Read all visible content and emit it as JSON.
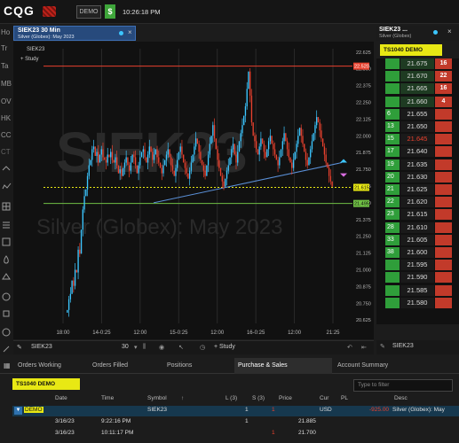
{
  "app": {
    "logo": "CQG",
    "demo_label": "DEMO",
    "dollar_label": "$",
    "clock": "10:26:18 PM",
    "accent_yellow": "#e8e814",
    "up_color": "#3cc6ff",
    "down_color": "#e8412e"
  },
  "rail": [
    "Ho",
    "Tr",
    "Ta",
    "MB",
    "OV",
    "HK",
    "CC",
    "CT"
  ],
  "chart_window": {
    "title": "SIEK23 30 Min",
    "subtitle": "Silver (Globex): May 2023",
    "legend_symbol": "SIEK23",
    "legend_study": "+ Study",
    "watermark_symbol": "SIEK23",
    "watermark_name": "Silver (Globex): May 2023"
  },
  "chart_data": {
    "type": "candlestick",
    "symbol": "SIEK23",
    "interval": "30 Min",
    "ylim": [
      20.6,
      22.65
    ],
    "y_ticks": [
      "22.625",
      "22.500",
      "22.375",
      "22.250",
      "22.125",
      "22.000",
      "21.875",
      "21.750",
      "21.625",
      "21.500",
      "21.375",
      "21.250",
      "21.125",
      "21.000",
      "20.875",
      "20.750",
      "20.625"
    ],
    "x_ticks": [
      "18:00",
      "14-0:25",
      "12:00",
      "15-0:25",
      "12:00",
      "16-0:25",
      "12:00",
      "21:25"
    ],
    "price_labels": [
      {
        "label": "22.520",
        "value": 22.52,
        "color": "#e8412e"
      },
      {
        "label": "21.615",
        "value": 21.615,
        "color": "#e8e814"
      },
      {
        "label": "21.495",
        "value": 21.495,
        "color": "#6fbf44"
      }
    ],
    "closes": [
      20.7,
      20.78,
      20.82,
      20.92,
      20.88,
      21.0,
      20.98,
      21.15,
      21.12,
      21.3,
      21.45,
      21.55,
      21.6,
      21.7,
      21.78,
      21.82,
      21.9,
      21.92,
      21.85,
      21.88,
      21.8,
      21.86,
      21.9,
      21.84,
      21.82,
      21.8,
      21.86,
      21.84,
      21.88,
      21.82,
      21.8,
      21.84,
      21.78,
      21.72,
      21.75,
      21.7,
      21.76,
      21.8,
      21.84,
      21.78,
      21.74,
      21.8,
      21.86,
      21.84,
      21.78,
      21.72,
      21.78,
      21.84,
      21.88,
      21.9,
      21.84,
      21.8,
      21.86,
      21.92,
      21.88,
      21.82,
      21.86,
      21.9,
      21.84,
      21.8,
      21.76,
      21.72,
      21.78,
      21.82,
      21.86,
      21.9,
      21.84,
      21.78,
      21.74,
      21.7,
      21.76,
      21.82,
      21.88,
      21.92,
      21.86,
      21.8,
      21.76,
      21.72,
      21.68,
      21.74,
      21.8,
      21.86,
      21.92,
      21.98,
      21.94,
      21.88,
      21.82,
      21.78,
      21.74,
      21.7,
      21.78,
      21.86,
      21.94,
      22.0,
      22.08,
      21.98,
      21.9,
      21.82,
      21.76,
      21.7,
      21.66,
      21.62,
      21.68,
      21.74,
      21.78,
      21.84,
      21.9,
      21.94,
      21.86,
      21.8,
      21.88,
      21.96,
      22.02,
      22.08,
      22.15,
      22.22,
      22.35,
      22.48,
      22.3,
      22.1,
      22.0,
      21.96,
      21.9,
      21.86,
      21.92,
      21.98,
      21.94,
      21.88,
      21.84,
      21.9,
      21.96,
      22.0,
      21.94,
      21.9,
      21.86,
      21.82,
      21.78,
      21.84,
      21.9,
      21.96,
      22.02,
      21.96,
      21.9,
      21.84,
      21.8,
      21.76,
      21.82,
      21.88,
      21.94,
      22.0,
      22.06,
      22.0,
      21.94,
      21.88,
      21.82,
      21.78,
      21.84,
      21.9,
      21.96,
      22.02,
      22.08,
      22.14,
      22.1,
      22.04,
      21.98,
      21.92,
      21.86,
      21.8,
      21.76,
      21.7,
      21.66,
      21.62
    ],
    "open": [
      20.68,
      20.7,
      20.78,
      20.82,
      20.92,
      20.88,
      21.0,
      20.98,
      21.15,
      21.12,
      21.3,
      21.45,
      21.55,
      21.6,
      21.7,
      21.78,
      21.82,
      21.9,
      21.92,
      21.85,
      21.88,
      21.8,
      21.86,
      21.9,
      21.84,
      21.82,
      21.8,
      21.86,
      21.84,
      21.88,
      21.82,
      21.8,
      21.84,
      21.78,
      21.72,
      21.75,
      21.7,
      21.76,
      21.8,
      21.84,
      21.78,
      21.74,
      21.8,
      21.86,
      21.84,
      21.78,
      21.72,
      21.78,
      21.84,
      21.88,
      21.9,
      21.84,
      21.8,
      21.86,
      21.92,
      21.88,
      21.82,
      21.86,
      21.9,
      21.84,
      21.8,
      21.76,
      21.72,
      21.78,
      21.82,
      21.86,
      21.9,
      21.84,
      21.78,
      21.74,
      21.7,
      21.76,
      21.82,
      21.88,
      21.92,
      21.86,
      21.8,
      21.76,
      21.72,
      21.68,
      21.74,
      21.8,
      21.86,
      21.92,
      21.98,
      21.94,
      21.88,
      21.82,
      21.78,
      21.74,
      21.7,
      21.78,
      21.86,
      21.94,
      22.0,
      22.08,
      21.98,
      21.9,
      21.82,
      21.76,
      21.7,
      21.66,
      21.62,
      21.68,
      21.74,
      21.78,
      21.84,
      21.9,
      21.94,
      21.86,
      21.8,
      21.88,
      21.96,
      22.02,
      22.08,
      22.15,
      22.22,
      22.35,
      22.48,
      22.3,
      22.1,
      22.0,
      21.96,
      21.9,
      21.86,
      21.92,
      21.98,
      21.94,
      21.88,
      21.84,
      21.9,
      21.96,
      22.0,
      21.94,
      21.9,
      21.86,
      21.82,
      21.78,
      21.84,
      21.9,
      21.96,
      22.02,
      21.96,
      21.9,
      21.84,
      21.8,
      21.76,
      21.82,
      21.88,
      21.94,
      22.0,
      22.06,
      22.0,
      21.94,
      21.88,
      21.82,
      21.78,
      21.84,
      21.9,
      21.96,
      22.02,
      22.08,
      22.14,
      22.1,
      22.04,
      21.98,
      21.92,
      21.86,
      21.8,
      21.76,
      21.7,
      21.66
    ],
    "high_extra": 0.05,
    "low_extra": 0.05
  },
  "chart_bar": {
    "symbol": "SIEK23",
    "interval": "30",
    "study": "+ Study"
  },
  "dom": {
    "title": "SIEK23 ...",
    "subtitle": "Silver (Globex)",
    "account": "TS1040 DEMO",
    "rows": [
      {
        "price": "21.675",
        "left": "",
        "right": "16",
        "zone": "ask"
      },
      {
        "price": "21.670",
        "left": "",
        "right": "22",
        "zone": "ask"
      },
      {
        "price": "21.665",
        "left": "",
        "right": "16",
        "zone": "ask"
      },
      {
        "price": "21.660",
        "left": "",
        "right": "4",
        "zone": "ask"
      },
      {
        "price": "21.655",
        "left": "6",
        "right": "",
        "zone": "mid"
      },
      {
        "price": "21.650",
        "left": "13",
        "right": "",
        "zone": "mid"
      },
      {
        "price": "21.645",
        "left": "15",
        "right": "",
        "zone": "last"
      },
      {
        "price": "21.640",
        "left": "17",
        "right": "",
        "zone": "mid"
      },
      {
        "price": "21.635",
        "left": "19",
        "right": "",
        "zone": "mid"
      },
      {
        "price": "21.630",
        "left": "20",
        "right": "",
        "zone": "mid"
      },
      {
        "price": "21.625",
        "left": "21",
        "right": "",
        "zone": "mid"
      },
      {
        "price": "21.620",
        "left": "22",
        "right": "",
        "zone": "mid"
      },
      {
        "price": "21.615",
        "left": "23",
        "right": "",
        "zone": "mid"
      },
      {
        "price": "21.610",
        "left": "28",
        "right": "",
        "zone": "mid"
      },
      {
        "price": "21.605",
        "left": "33",
        "right": "",
        "zone": "mid"
      },
      {
        "price": "21.600",
        "left": "38",
        "right": "",
        "zone": "mid"
      },
      {
        "price": "21.595",
        "left": "",
        "right": "",
        "zone": "mid"
      },
      {
        "price": "21.590",
        "left": "",
        "right": "",
        "zone": "mid"
      },
      {
        "price": "21.585",
        "left": "",
        "right": "",
        "zone": "mid"
      },
      {
        "price": "21.580",
        "left": "",
        "right": "",
        "zone": "mid"
      }
    ],
    "bottom_symbol": "SIEK23"
  },
  "orders": {
    "tabs": [
      "Orders Working",
      "Orders Filled",
      "Positions",
      "Purchase & Sales",
      "Account Summary"
    ],
    "active_tab": "Purchase & Sales",
    "account": "TS1040 DEMO",
    "filter_placeholder": "Type to filter",
    "columns": [
      "Date",
      "Time",
      "Symbol",
      "L (3)",
      "S (3)",
      "Price",
      "Cur",
      "PL",
      "Desc"
    ],
    "rows": [
      {
        "account": "DEMO",
        "date": "",
        "time": "",
        "symbol": "SIEK23",
        "l": "1",
        "s": "1",
        "price": "",
        "cur": "USD",
        "pl": "-925.00",
        "desc": "Silver (Globex): May"
      },
      {
        "account": "",
        "date": "3/16/23",
        "time": "9:22:16 PM",
        "symbol": "",
        "l": "1",
        "s": "",
        "price": "21.885",
        "cur": "",
        "pl": "",
        "desc": ""
      },
      {
        "account": "",
        "date": "3/16/23",
        "time": "10:11:17 PM",
        "symbol": "",
        "l": "",
        "s": "1",
        "price": "21.700",
        "cur": "",
        "pl": "",
        "desc": ""
      }
    ]
  }
}
